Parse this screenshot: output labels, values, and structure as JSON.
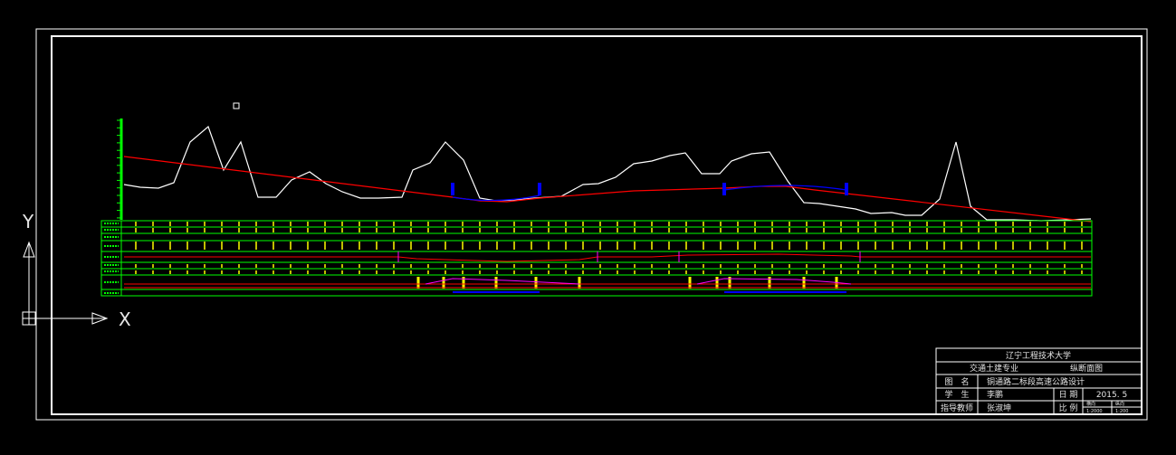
{
  "drawing": {
    "ucs": {
      "y_label": "Y",
      "x_label": "X"
    },
    "colors": {
      "background": "#000000",
      "frame": "#ffffff",
      "ground_line": "#ffffff",
      "design_line": "#ff0000",
      "band_grid": "#00ff00",
      "band_marks": "#ffff00",
      "structure": "#0000ff",
      "curve_line": "#ff00ff"
    }
  },
  "title_block": {
    "university": "辽宁工程技术大学",
    "major": "交通土建专业",
    "drawing_type": "纵断面图",
    "drawing_name_label": "图　名",
    "drawing_name": "铜通路二标段高速公路设计",
    "student_label": "学　生",
    "student_name": "李鹏",
    "date_label": "日 期",
    "date_value": "2015. 5",
    "advisor_label": "指导教师",
    "advisor_name": "张淑坤",
    "scale_label": "比 例",
    "scale_h_label": "横向",
    "scale_v_label": "纵向",
    "scale_h_value": "1:2000",
    "scale_v_value": "1:200"
  }
}
